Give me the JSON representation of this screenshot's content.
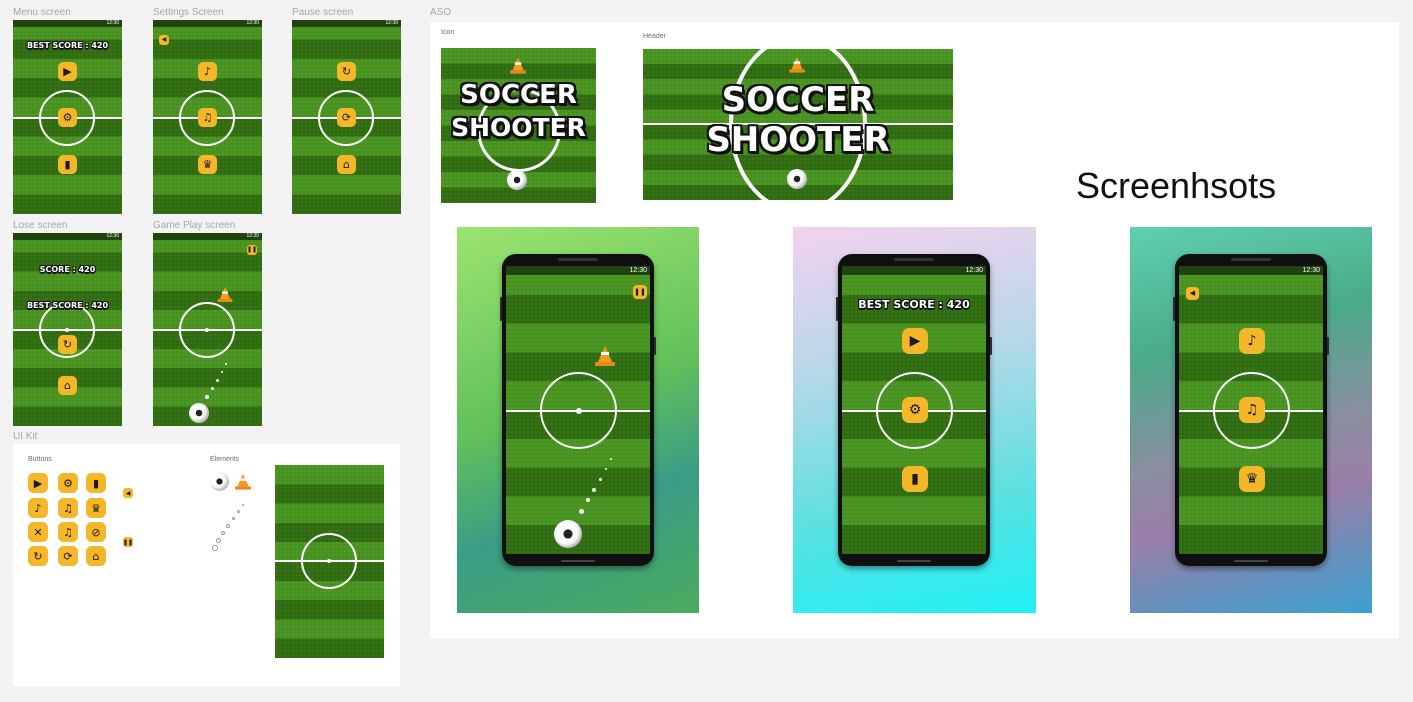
{
  "frames": {
    "menu": "Menu screen",
    "settings": "Settings Screen",
    "pause": "Pause screen",
    "lose": "Lose screen",
    "gameplay": "Game Play screen",
    "uikit": "UI Kit",
    "aso": "ASO"
  },
  "status_time": "12:30",
  "menu": {
    "best_score": "BEST SCORE : 420"
  },
  "lose": {
    "score": "SCORE : 420",
    "best_score": "BEST SCORE : 420"
  },
  "uikit": {
    "buttons_label": "Buttons",
    "elements_label": "Elements"
  },
  "aso": {
    "icon_label": "Icon",
    "header_label": "Header",
    "title_line1": "SOCCER",
    "title_line2": "SHOOTER",
    "screenshots_label": "Screenhsots",
    "shot2_best": "BEST SCORE : 420"
  },
  "icons": {
    "play": "play-icon",
    "settings": "gear-icon",
    "exit": "exit-door-icon",
    "back": "back-arrow-icon",
    "sound": "speaker-icon",
    "music": "music-note-icon",
    "trophy": "trophy-icon",
    "restart": "restart-icon",
    "reload": "refresh-icon",
    "home": "home-icon",
    "pause": "pause-icon",
    "mute": "mute-icon",
    "no_trophy": "trophy-off-icon"
  },
  "colors": {
    "button": "#f4b72a",
    "grass_light": "#47921f",
    "grass_dark": "#2f6c10"
  }
}
